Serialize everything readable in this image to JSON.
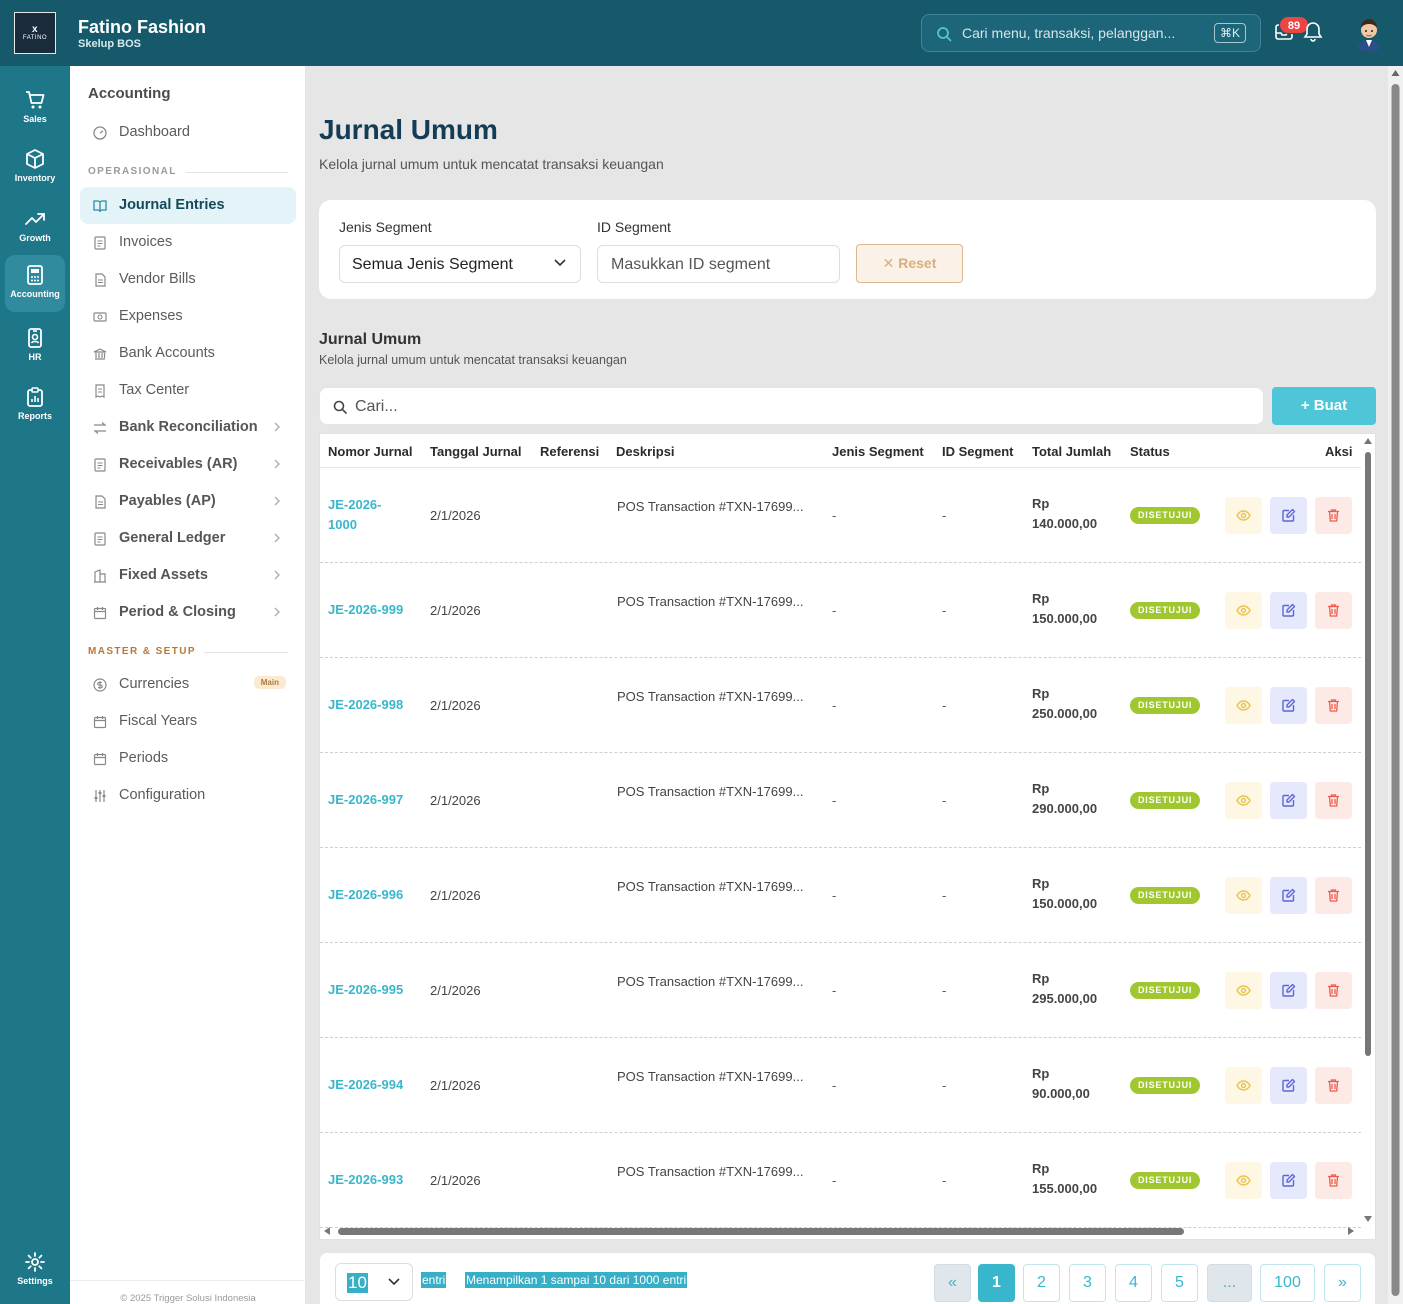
{
  "app": {
    "logo_text": "FATINO",
    "name": "Fatino Fashion",
    "subtitle": "Skelup BOS"
  },
  "topbar": {
    "search_placeholder": "Cari menu, transaksi, pelanggan...",
    "shortcut": "⌘K",
    "notification_count": "89"
  },
  "rail": {
    "items": [
      {
        "label": "Sales",
        "icon": "cart-icon"
      },
      {
        "label": "Inventory",
        "icon": "box-icon"
      },
      {
        "label": "Growth",
        "icon": "trend-icon"
      },
      {
        "label": "Accounting",
        "icon": "calculator-icon",
        "active": true
      },
      {
        "label": "HR",
        "icon": "badge-icon"
      },
      {
        "label": "Reports",
        "icon": "clipboard-icon"
      }
    ],
    "settings_label": "Settings"
  },
  "sidebar": {
    "title": "Accounting",
    "dashboard": "Dashboard",
    "section_operasional": "OPERASIONAL",
    "operasional": [
      {
        "label": "Journal Entries",
        "icon": "book-icon",
        "active": true
      },
      {
        "label": "Invoices",
        "icon": "document-icon"
      },
      {
        "label": "Vendor Bills",
        "icon": "document-icon"
      },
      {
        "label": "Expenses",
        "icon": "cash-icon"
      },
      {
        "label": "Bank Accounts",
        "icon": "bank-icon"
      },
      {
        "label": "Tax Center",
        "icon": "receipt-icon"
      },
      {
        "label": "Bank Reconciliation",
        "icon": "swap-icon",
        "expandable": true
      },
      {
        "label": "Receivables (AR)",
        "icon": "document-icon",
        "expandable": true
      },
      {
        "label": "Payables (AP)",
        "icon": "document-icon",
        "expandable": true
      },
      {
        "label": "General Ledger",
        "icon": "document-icon",
        "expandable": true
      },
      {
        "label": "Fixed Assets",
        "icon": "building-icon",
        "expandable": true
      },
      {
        "label": "Period & Closing",
        "icon": "calendar-icon",
        "expandable": true
      }
    ],
    "section_master": "MASTER & SETUP",
    "master": [
      {
        "label": "Currencies",
        "icon": "currency-icon",
        "badge": "Main"
      },
      {
        "label": "Fiscal Years",
        "icon": "calendar-icon"
      },
      {
        "label": "Periods",
        "icon": "calendar-icon"
      },
      {
        "label": "Configuration",
        "icon": "sliders-icon"
      }
    ],
    "copyright": "© 2025 Trigger Solusi Indonesia"
  },
  "page": {
    "title": "Jurnal Umum",
    "subtitle": "Kelola jurnal umum untuk mencatat transaksi keuangan"
  },
  "filters": {
    "segment_type_label": "Jenis Segment",
    "segment_type_value": "Semua Jenis Segment",
    "segment_id_label": "ID Segment",
    "segment_id_placeholder": "Masukkan ID segment",
    "reset_label": "Reset"
  },
  "table_section": {
    "title": "Jurnal Umum",
    "subtitle": "Kelola jurnal umum untuk mencatat transaksi keuangan",
    "search_placeholder": "Cari...",
    "create_label": "Buat"
  },
  "table": {
    "columns": [
      "Nomor Jurnal",
      "Tanggal Jurnal",
      "Referensi",
      "Deskripsi",
      "Jenis Segment",
      "ID Segment",
      "Total Jumlah",
      "Status",
      "Aksi"
    ],
    "rows": [
      {
        "number": "JE-2026-1000",
        "date": "2/1/2026",
        "reference": "",
        "description": "POS Transaction #TXN-17699...",
        "segment_type": "-",
        "segment_id": "-",
        "currency": "Rp",
        "amount": "140.000,00",
        "status": "DISETUJUI"
      },
      {
        "number": "JE-2026-999",
        "date": "2/1/2026",
        "reference": "",
        "description": "POS Transaction #TXN-17699...",
        "segment_type": "-",
        "segment_id": "-",
        "currency": "Rp",
        "amount": "150.000,00",
        "status": "DISETUJUI"
      },
      {
        "number": "JE-2026-998",
        "date": "2/1/2026",
        "reference": "",
        "description": "POS Transaction #TXN-17699...",
        "segment_type": "-",
        "segment_id": "-",
        "currency": "Rp",
        "amount": "250.000,00",
        "status": "DISETUJUI"
      },
      {
        "number": "JE-2026-997",
        "date": "2/1/2026",
        "reference": "",
        "description": "POS Transaction #TXN-17699...",
        "segment_type": "-",
        "segment_id": "-",
        "currency": "Rp",
        "amount": "290.000,00",
        "status": "DISETUJUI"
      },
      {
        "number": "JE-2026-996",
        "date": "2/1/2026",
        "reference": "",
        "description": "POS Transaction #TXN-17699...",
        "segment_type": "-",
        "segment_id": "-",
        "currency": "Rp",
        "amount": "150.000,00",
        "status": "DISETUJUI"
      },
      {
        "number": "JE-2026-995",
        "date": "2/1/2026",
        "reference": "",
        "description": "POS Transaction #TXN-17699...",
        "segment_type": "-",
        "segment_id": "-",
        "currency": "Rp",
        "amount": "295.000,00",
        "status": "DISETUJUI"
      },
      {
        "number": "JE-2026-994",
        "date": "2/1/2026",
        "reference": "",
        "description": "POS Transaction #TXN-17699...",
        "segment_type": "-",
        "segment_id": "-",
        "currency": "Rp",
        "amount": "90.000,00",
        "status": "DISETUJUI"
      },
      {
        "number": "JE-2026-993",
        "date": "2/1/2026",
        "reference": "",
        "description": "POS Transaction #TXN-17699...",
        "segment_type": "-",
        "segment_id": "-",
        "currency": "Rp",
        "amount": "155.000,00",
        "status": "DISETUJUI"
      }
    ]
  },
  "pagination": {
    "per_page": "10",
    "entries_label": "entri",
    "info": "Menampilkan 1 sampai 10 dari 1000 entri",
    "first": "«",
    "pages": [
      "1",
      "2",
      "3",
      "4",
      "5"
    ],
    "ellipsis": "...",
    "last_page": "100",
    "next": "»",
    "current_page": "1"
  },
  "colors": {
    "topbar": "#16596b",
    "rail": "#1d7789",
    "accent": "#38b7cc",
    "status_approved": "#a1c730",
    "page_title": "#143c56"
  }
}
